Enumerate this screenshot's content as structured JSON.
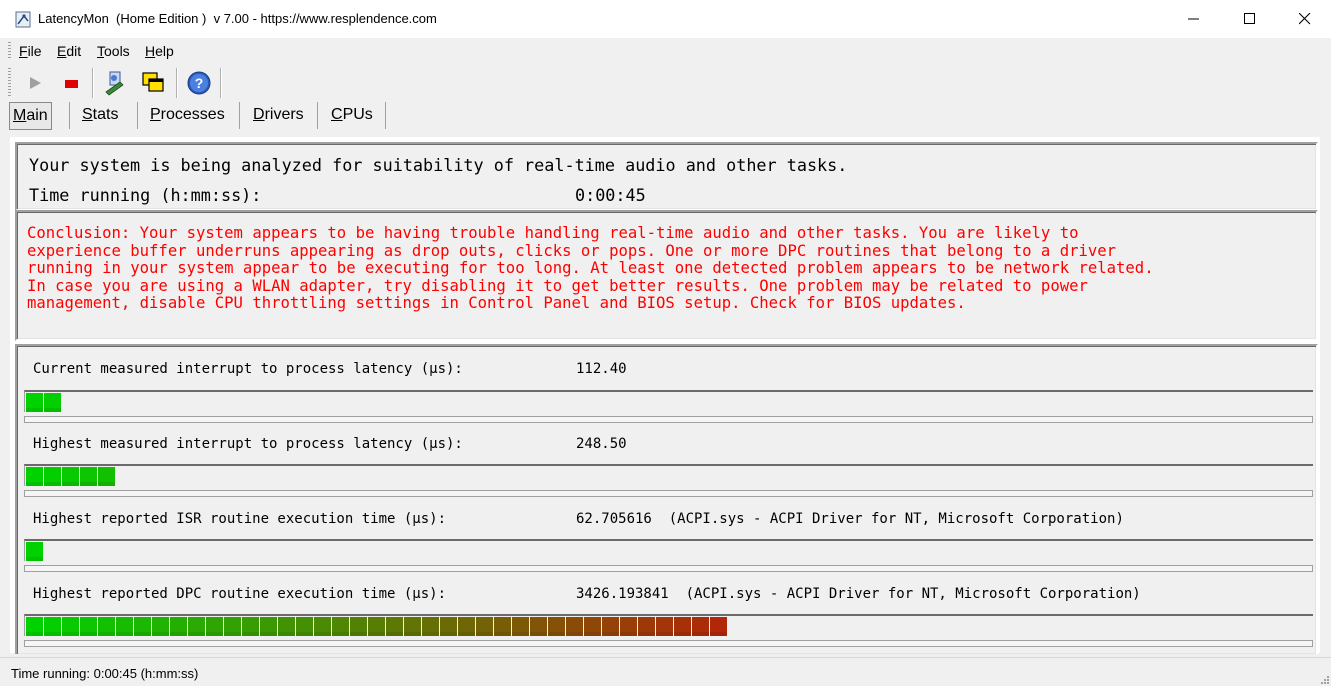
{
  "window": {
    "title": "LatencyMon  (Home Edition )  v 7.00 - https://www.resplendence.com",
    "controls": [
      "minimize",
      "maximize",
      "close"
    ]
  },
  "menu": [
    {
      "ul": "F",
      "rest": "ile"
    },
    {
      "ul": "E",
      "rest": "dit"
    },
    {
      "ul": "T",
      "rest": "ools"
    },
    {
      "ul": "H",
      "rest": "elp"
    }
  ],
  "toolbar": {
    "buttons": [
      {
        "icon": "play-icon",
        "enabled": false
      },
      {
        "icon": "stop-icon",
        "color": "#e00000"
      },
      {
        "icon": "driver-update-icon"
      },
      {
        "icon": "windows-icon"
      },
      {
        "icon": "help-icon"
      }
    ]
  },
  "tabs": [
    {
      "ul": "M",
      "rest": "ain",
      "active": true
    },
    {
      "ul": "S",
      "rest": "tats",
      "active": false
    },
    {
      "ul": "P",
      "rest": "rocesses",
      "active": false
    },
    {
      "ul": "D",
      "rest": "rivers",
      "active": false
    },
    {
      "ul": "C",
      "rest": "PUs",
      "active": false
    }
  ],
  "status": {
    "message": "Your system is being analyzed for suitability of real-time audio and other tasks.",
    "time_label": "Time running (h:mm:ss):",
    "time_value": "0:00:45"
  },
  "conclusion": "Conclusion: Your system appears to be having trouble handling real-time audio and other tasks. You are likely to\nexperience buffer underruns appearing as drop outs, clicks or pops. One or more DPC routines that belong to a driver\nrunning in your system appear to be executing for too long. At least one detected problem appears to be network related.\nIn case you are using a WLAN adapter, try disabling it to get better results. One problem may be related to power\nmanagement, disable CPU throttling settings in Control Panel and BIOS setup. Check for BIOS updates.",
  "conclusion_color": "#ff0000",
  "metrics": [
    {
      "label": "Current measured interrupt to process latency (µs):",
      "value": "112.40",
      "segments_filled": 2
    },
    {
      "label": "Highest measured interrupt to process latency (µs):",
      "value": "248.50",
      "segments_filled": 5
    },
    {
      "label": "Highest reported ISR routine execution time (µs):",
      "value": "62.705616  (ACPI.sys - ACPI Driver for NT, Microsoft Corporation)",
      "segments_filled": 1
    },
    {
      "label": "Highest reported DPC routine execution time (µs):",
      "value": "3426.193841  (ACPI.sys - ACPI Driver for NT, Microsoft Corporation)",
      "segments_filled": 39
    }
  ],
  "statusbar": {
    "text": "Time running: 0:00:45  (h:mm:ss)"
  }
}
